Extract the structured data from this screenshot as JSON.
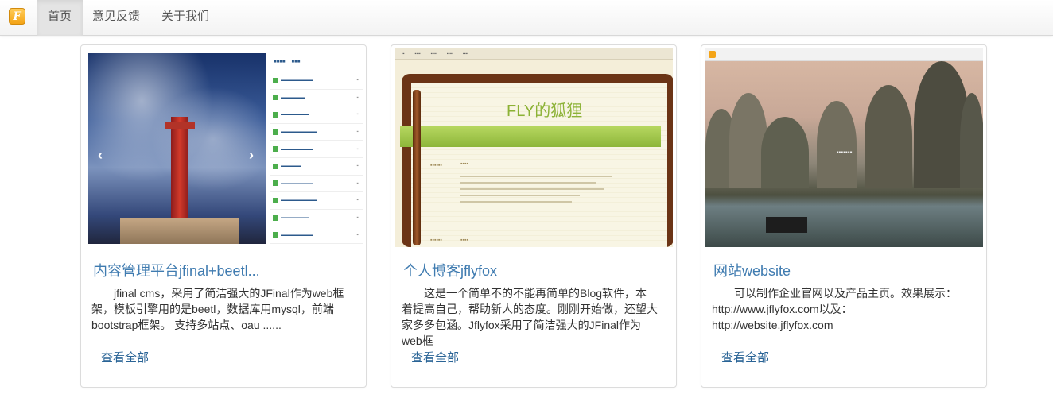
{
  "navbar": {
    "brand_letter": "F",
    "items": [
      {
        "label": "首页",
        "active": true
      },
      {
        "label": "意见反馈",
        "active": false
      },
      {
        "label": "关于我们",
        "active": false
      }
    ]
  },
  "cards": [
    {
      "title": "内容管理平台jfinal+beetl...",
      "description": "jfinal cms，采用了简洁强大的JFinal作为web框架，模板引擎用的是beetl，数据库用mysql，前端bootstrap框架。 支持多站点、oau ......",
      "link": "查看全部",
      "thumbnail": "cms-screenshot"
    },
    {
      "title": "个人博客jflyfox",
      "description": "这是一个简单不的不能再简单的Blog软件，本着提高自己，帮助新人的态度。刚刚开始做，还望大家多多包涵。Jflyfox采用了简洁强大的JFinal作为web框",
      "link": "查看全部",
      "thumbnail": "blog-screenshot",
      "thumbnail_text": "FLY的狐狸"
    },
    {
      "title": "网站website",
      "description": "可以制作企业官网以及产品主页。效果展示：http://www.jflyfox.com以及：http://website.jflyfox.com",
      "link": "查看全部",
      "thumbnail": "website-screenshot"
    }
  ],
  "colors": {
    "link": "#2a6496",
    "title": "#3f7bb0",
    "brand": "#f4a417"
  }
}
